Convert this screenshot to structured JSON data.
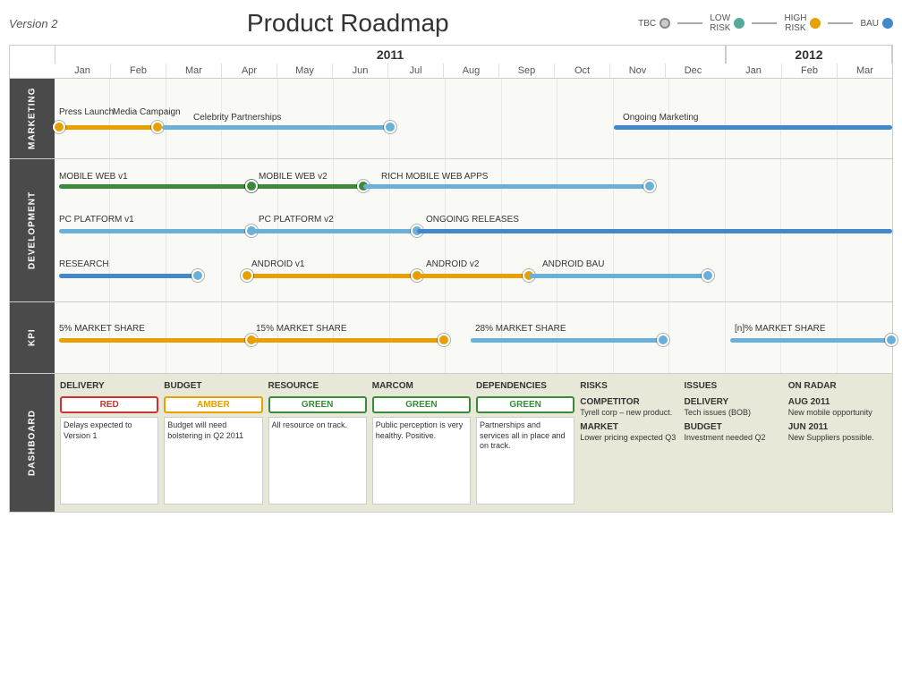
{
  "header": {
    "version": "Version 2",
    "title": "Product Roadmap"
  },
  "legend": {
    "items": [
      {
        "label": "TBC"
      },
      {
        "label": "LOW\nRISK"
      },
      {
        "label": "HIGH\nRISK"
      },
      {
        "label": "BAU"
      }
    ]
  },
  "timeline": {
    "years": [
      {
        "label": "2011",
        "months": [
          "Jan",
          "Feb",
          "Mar",
          "Apr",
          "May",
          "Jun",
          "Jul",
          "Aug",
          "Sep",
          "Oct",
          "Nov",
          "Dec"
        ]
      },
      {
        "label": "2012",
        "months": [
          "Jan",
          "Feb",
          "Mar"
        ]
      }
    ]
  },
  "sections": [
    {
      "name": "MARKETING",
      "items": [
        {
          "label": "Press\nLaunch",
          "label2": "Media\nCampaign"
        },
        {
          "label": "Celebrity Partnerships"
        },
        {
          "label": "Ongoing Marketing"
        }
      ]
    },
    {
      "name": "DEVELOPMENT",
      "items": [
        {
          "label": "MOBILE WEB v1"
        },
        {
          "label": "MOBILE WEB v2"
        },
        {
          "label": "RICH MOBILE  WEB APPS"
        },
        {
          "label": "PC PLATFORM  v1"
        },
        {
          "label": "PC PLATFORM v2"
        },
        {
          "label": "ONGOING RELEASES"
        },
        {
          "label": "RESEARCH"
        },
        {
          "label": "ANDROID v1"
        },
        {
          "label": "ANDROID v2"
        },
        {
          "label": "ANDROID BAU"
        }
      ]
    },
    {
      "name": "KPI",
      "items": [
        {
          "label": "5% MARKET  SHARE"
        },
        {
          "label": "15% MARKET  SHARE"
        },
        {
          "label": "28% MARKET  SHARE"
        },
        {
          "label": "[n]% MARKET SHARE"
        }
      ]
    },
    {
      "name": "DASHBOARD"
    }
  ],
  "dashboard": {
    "delivery": {
      "title": "DELIVERY",
      "status": "RED",
      "text": "Delays expected to Version 1"
    },
    "budget": {
      "title": "BUDGET",
      "status": "AMBER",
      "text": "Budget will need bolstering in Q2 2011"
    },
    "resource": {
      "title": "RESOURCE",
      "status": "GREEN",
      "text": "All resource on track."
    },
    "marcom": {
      "title": "MARCOM",
      "status": "GREEN",
      "text": "Public perception is very healthy. Positive."
    },
    "dependencies": {
      "title": "DEPENDENCIES",
      "status": "GREEN",
      "text": "Partnerships and services all in place and on track."
    },
    "risks": {
      "title": "RISKS",
      "items": [
        {
          "title": "COMPETITOR",
          "text": "Tyrell corp – new product."
        },
        {
          "title": "MARKET",
          "text": "Lower pricing expected Q3"
        }
      ]
    },
    "issues": {
      "title": "ISSUES",
      "items": [
        {
          "title": "DELIVERY",
          "text": "Tech issues (BOB)"
        },
        {
          "title": "BUDGET",
          "text": "Investment needed Q2"
        }
      ]
    },
    "radar": {
      "title": "ON RADAR",
      "items": [
        {
          "title": "AUG 2011",
          "text": "New mobile opportunity"
        },
        {
          "title": "JUN 2011",
          "text": "New Suppliers possible."
        }
      ]
    }
  }
}
